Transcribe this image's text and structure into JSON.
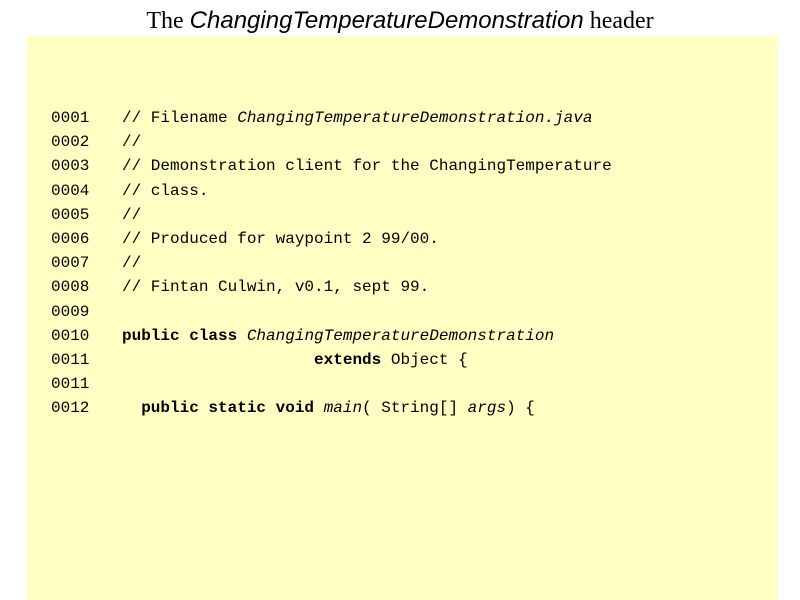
{
  "title": {
    "prefix": "The ",
    "name": "ChangingTemperatureDemonstration",
    "suffix": " header"
  },
  "colors": {
    "panel_background": "#ffffc4",
    "text": "#000000"
  },
  "code_lines": [
    {
      "num": "0001",
      "segments": [
        {
          "t": "// Filename "
        },
        {
          "t": "ChangingTemperatureDemonstration.java",
          "style": "it"
        }
      ]
    },
    {
      "num": "0002",
      "segments": [
        {
          "t": "//"
        }
      ]
    },
    {
      "num": "0003",
      "segments": [
        {
          "t": "// Demonstration client for the ChangingTemperature"
        }
      ]
    },
    {
      "num": "0004",
      "segments": [
        {
          "t": "// class."
        }
      ]
    },
    {
      "num": "0005",
      "segments": [
        {
          "t": "//"
        }
      ]
    },
    {
      "num": "0006",
      "segments": [
        {
          "t": "// Produced for waypoint 2 99/00."
        }
      ]
    },
    {
      "num": "0007",
      "segments": [
        {
          "t": "//"
        }
      ]
    },
    {
      "num": "0008",
      "segments": [
        {
          "t": "// Fintan Culwin, v0.1, sept 99."
        }
      ]
    },
    {
      "num": "0009",
      "segments": []
    },
    {
      "num": "0010",
      "segments": [
        {
          "t": "public class ",
          "style": "kw"
        },
        {
          "t": "ChangingTemperatureDemonstration",
          "style": "it"
        }
      ]
    },
    {
      "num": "0011",
      "segments": [
        {
          "t": "                    "
        },
        {
          "t": "extends",
          "style": "kw"
        },
        {
          "t": " Object {"
        }
      ]
    },
    {
      "num": "0011",
      "segments": []
    },
    {
      "num": "0012",
      "segments": [
        {
          "t": "  "
        },
        {
          "t": "public static void ",
          "style": "kw"
        },
        {
          "t": "main",
          "style": "it"
        },
        {
          "t": "( String[] "
        },
        {
          "t": "args",
          "style": "it"
        },
        {
          "t": ") {"
        }
      ]
    }
  ]
}
